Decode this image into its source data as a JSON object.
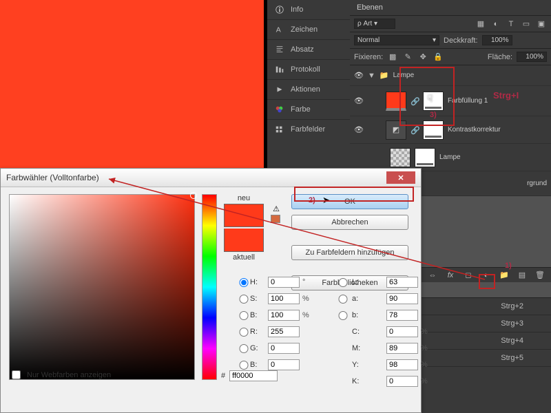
{
  "canvas_color": "#ff4020",
  "mid_panel": {
    "items": [
      "Info",
      "Zeichen",
      "Absatz",
      "Protokoll",
      "Aktionen",
      "Farbe",
      "Farbfelder"
    ]
  },
  "layers": {
    "title": "Ebenen",
    "kind_label": "Art",
    "blend_mode": "Normal",
    "opacity_label": "Deckkraft:",
    "opacity_value": "100%",
    "lock_label": "Fixieren:",
    "fill_label": "Fläche:",
    "fill_value": "100%",
    "group_name": "Lampe",
    "fill_layer": "Farbfüllung 1",
    "adjust_layer": "Kontrastkorrektur",
    "lamp_layer": "Lampe",
    "bg_layer": "rgrund",
    "shortcut_ctrl_i": "Strg+I",
    "annot_1": "1)",
    "annot_2": "2)",
    "annot_3": "3)"
  },
  "history": {
    "items": [
      "Strg+2",
      "Strg+3",
      "Strg+4",
      "Strg+5"
    ]
  },
  "dialog": {
    "title": "Farbwähler (Volltonfarbe)",
    "new_label": "neu",
    "current_label": "aktuell",
    "ok": "OK",
    "cancel": "Abbrechen",
    "add_swatch": "Zu Farbfeldern hinzufügen",
    "libraries": "Farbbibliotheken",
    "webonly": "Nur Webfarben anzeigen",
    "hex_label": "#",
    "hex_value": "ff0000",
    "H": "0",
    "S": "100",
    "Bv": "100",
    "R": "255",
    "G": "0",
    "B": "0",
    "L": "63",
    "a": "90",
    "b": "78",
    "C": "0",
    "M": "89",
    "Y": "98",
    "K": "0",
    "deg": "°",
    "pct": "%"
  }
}
